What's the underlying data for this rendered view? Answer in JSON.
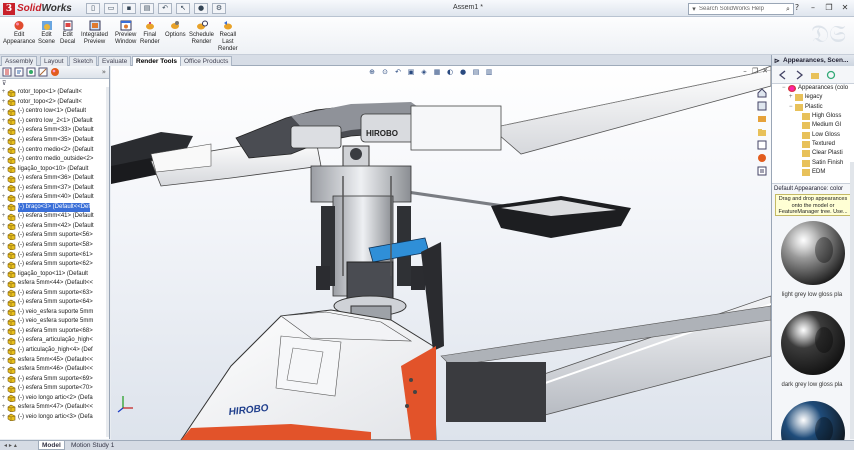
{
  "app": {
    "brand": "SolidWorks",
    "document_title": "Assem1 *"
  },
  "search": {
    "placeholder": "Search SolidWorks Help"
  },
  "ribbon": {
    "buttons": [
      {
        "label": "Edit\nAppearance",
        "icon": "paint-ball-icon"
      },
      {
        "label": "Edit\nScene",
        "icon": "scene-icon"
      },
      {
        "label": "Edit\nDecal",
        "icon": "decal-icon"
      },
      {
        "label": "Integrated\nPreview",
        "icon": "preview-icon"
      },
      {
        "label": "Preview\nWindow",
        "icon": "window-icon"
      },
      {
        "label": "Final\nRender",
        "icon": "render-teapot-icon"
      },
      {
        "label": "Options",
        "icon": "options-icon"
      },
      {
        "label": "Schedule\nRender",
        "icon": "schedule-icon"
      },
      {
        "label": "Recall\nLast\nRender",
        "icon": "recall-icon"
      }
    ]
  },
  "command_tabs": [
    "Assembly",
    "Layout",
    "Sketch",
    "Evaluate",
    "Render Tools",
    "Office Products"
  ],
  "active_command_tab": "Render Tools",
  "feature_tree": {
    "items": [
      "rotor_topo<1> (Default<",
      "rotor_topo<2> (Default<",
      "(-) centro low<1> (Default",
      "(-) centro low_2<1> (Default",
      "(-) esfera 5mm<33> (Default",
      "(-) esfera 5mm<35> (Default",
      "(-) centro medio<2> (Default",
      "(-) centro medio_outside<2>",
      "ligação_topo<10> (Default",
      "(-) esfera 5mm<36> (Default",
      "(-) esfera 5mm<37> (Default",
      "(-) esfera 5mm<40> (Default",
      "(-) braço<3> (Default<<Def",
      "(-) esfera 5mm<41> (Default",
      "(-) esfera 5mm<42> (Default",
      "(-) esfera 5mm suporte<56>",
      "(-) esfera 5mm suporte<58>",
      "(-) esfera 5mm suporte<61>",
      "(-) esfera 5mm suporte<62>",
      "ligação_topo<11> (Default",
      "esfera 5mm<44> (Default<<",
      "(-) esfera 5mm suporte<63>",
      "(-) esfera 5mm suporte<64>",
      "(-) veio_esfera suporte 5mm",
      "(-) veio_esfera suporte 5mm",
      "(-) esfera 5mm suporte<68>",
      "(-) esfera_articulação_high<",
      "(-) articulação_high<4> (Def",
      "esfera 5mm<45> (Default<<",
      "esfera 5mm<46> (Default<<",
      "(-) esfera 5mm suporte<69>",
      "(-) esfera 5mm suporte<70>",
      "(-) veio longo artic<2> (Defa",
      "esfera 5mm<47> (Default<<",
      "(-) veio longo artic<3> (Defa"
    ],
    "selected_index": 12
  },
  "task_pane": {
    "title": "Appearances, Scen...",
    "tree": [
      {
        "label": "Appearances (colo",
        "level": 0,
        "exp": "−"
      },
      {
        "label": "legacy",
        "level": 1,
        "exp": "+"
      },
      {
        "label": "Plastic",
        "level": 1,
        "exp": "−"
      },
      {
        "label": "High Gloss",
        "level": 2,
        "exp": ""
      },
      {
        "label": "Medium Gl",
        "level": 2,
        "exp": ""
      },
      {
        "label": "Low Gloss",
        "level": 2,
        "exp": ""
      },
      {
        "label": "Textured",
        "level": 2,
        "exp": ""
      },
      {
        "label": "Clear Plasti",
        "level": 2,
        "exp": ""
      },
      {
        "label": "Satin Finish",
        "level": 2,
        "exp": ""
      },
      {
        "label": "EDM",
        "level": 2,
        "exp": ""
      }
    ],
    "section_label": "Default Appearance: color",
    "tip": "Drag and drop appearances onto the model or FeatureManager tree. Use...",
    "swatches": [
      {
        "caption": "light grey low gloss pla",
        "color": "#9a9a9a"
      },
      {
        "caption": "dark grey low gloss pla",
        "color": "#3c3c3c"
      },
      {
        "caption": "",
        "color": "#1f4c7a"
      }
    ]
  },
  "bottom_tabs": [
    "Model",
    "Motion Study 1"
  ],
  "active_bottom_tab": "Model",
  "model_text": "HIROBO"
}
